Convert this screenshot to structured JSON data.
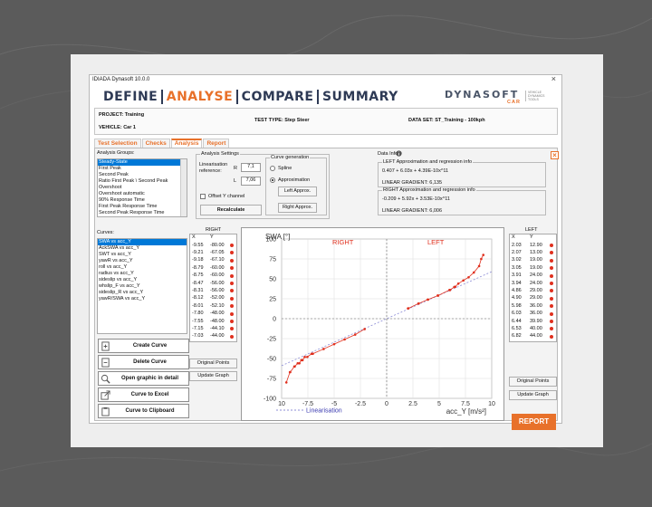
{
  "window": {
    "title": "IDIADA Dynasoft 10.0.0",
    "close": "×"
  },
  "nav": {
    "define": "DEFINE",
    "analyse": "ANALYSE",
    "compare": "COMPARE",
    "summary": "SUMMARY"
  },
  "logo": {
    "main": "DYNASOFT",
    "sub": "CAR",
    "tagline": "VEHICLE DYNAMICS TOOLS"
  },
  "info": {
    "project": "PROJECT: Training",
    "vehicle": "VEHICLE: Car 1",
    "test_type": "TEST TYPE: Step Steer",
    "data_set": "DATA SET: ST_Training - 100kph"
  },
  "tabs": [
    "Test Selection",
    "Checks",
    "Analysis",
    "Report"
  ],
  "analysis_groups": {
    "label": "Analysis Groups:",
    "items": [
      "Steady-State",
      "First Peak",
      "Second Peak",
      "Ratio First Peak \\ Second Peak",
      "Overshoot",
      "Overshoot automatic",
      "90% Response Time",
      "First Peak Response Time",
      "Second Peak Response Time"
    ],
    "selected": 0
  },
  "curves": {
    "label": "Curves:",
    "items": [
      "SWA vs acc_Y",
      "AckSWA vs acc_Y",
      "SWT vs acc_Y",
      "yawR vs acc_Y",
      "roll vs acc_Y",
      "radius vs acc_Y",
      "sideslip vs acc_Y",
      "whslip_F vs acc_Y",
      "sideslip_R vs acc_Y",
      "yawR/SWA vs acc_Y"
    ],
    "selected": 0
  },
  "analysis_settings": {
    "title": "Analysis Settings",
    "linearisation_label": "Linearisation reference:",
    "r_label": "R",
    "r_value": "7,1",
    "l_label": "L",
    "l_value": "7,06",
    "offset_label": "Offset Y channel",
    "recalculate": "Recalculate"
  },
  "curve_generation": {
    "title": "Curve generation",
    "spline": "Spline",
    "approximation": "Approximation",
    "left_btn": "Left Approx.",
    "right_btn": "Right Approx."
  },
  "data_info": {
    "title": "Data Info",
    "left_title": "LEFT Approximation and regression info",
    "left_eq": "0.407 + 6.03x + 4.39E-10x^11",
    "left_grad": "LINEAR GRADIENT: 6,135",
    "right_title": "RIGHT Approximation and regression info",
    "right_eq": "-0.209 + 5.92x + 3.53E-10x^11",
    "right_grad": "LINEAR GRADIENT: 6,006"
  },
  "right_table": {
    "title": "RIGHT",
    "col_x": "X",
    "col_y": "Y",
    "rows": [
      [
        "-9.55",
        "-80.00"
      ],
      [
        "-9.21",
        "-67.05"
      ],
      [
        "-9.18",
        "-67.10"
      ],
      [
        "-8.79",
        "-60.00"
      ],
      [
        "-8.75",
        "-60.00"
      ],
      [
        "-8.47",
        "-56.00"
      ],
      [
        "-8.31",
        "-56.00"
      ],
      [
        "-8.12",
        "-52.00"
      ],
      [
        "-8.01",
        "-52.10"
      ],
      [
        "-7.80",
        "-48.00"
      ],
      [
        "-7.55",
        "-48.00"
      ],
      [
        "-7.15",
        "-44.10"
      ],
      [
        "-7.03",
        "-44.00"
      ]
    ],
    "btn_original": "Original Points",
    "btn_update": "Update Graph"
  },
  "left_table": {
    "title": "LEFT",
    "col_x": "X",
    "col_y": "Y",
    "rows": [
      [
        "2.03",
        "12.90"
      ],
      [
        "2.07",
        "13.00"
      ],
      [
        "3.02",
        "19.00"
      ],
      [
        "3.05",
        "19.00"
      ],
      [
        "3.91",
        "24.00"
      ],
      [
        "3.94",
        "24.00"
      ],
      [
        "4.86",
        "29.00"
      ],
      [
        "4.90",
        "29.00"
      ],
      [
        "5.98",
        "36.00"
      ],
      [
        "6.03",
        "36.00"
      ],
      [
        "6.44",
        "39.90"
      ],
      [
        "6.53",
        "40.00"
      ],
      [
        "6.82",
        "44.00"
      ]
    ],
    "btn_original": "Original Points",
    "btn_update": "Update Graph"
  },
  "actions": {
    "create": "Create Curve",
    "delete": "Delete Curve",
    "open": "Open graphic in detail",
    "excel": "Curve to Excel",
    "clipboard": "Curve to Clipboard"
  },
  "report_btn": "REPORT",
  "chart_data": {
    "type": "scatter",
    "ylabel": "SWA [°]",
    "xlabel": "acc_Y [m/s²]",
    "region_right": "RIGHT",
    "region_left": "LEFT",
    "legend": "Linearisation",
    "xlim": [
      -10,
      10
    ],
    "ylim": [
      -100,
      100
    ],
    "x_ticks": [
      "10",
      "-7.5",
      "-5",
      "-2.5",
      "0",
      "2.5",
      "5",
      "7.5",
      "10"
    ],
    "y_ticks": [
      "100",
      "75",
      "50",
      "25",
      "0",
      "-25",
      "-50",
      "-75",
      "-100"
    ],
    "series": [
      {
        "values": [
          [
            -9.55,
            -80
          ],
          [
            -9.21,
            -67.05
          ],
          [
            -9.18,
            -67.1
          ],
          [
            -8.79,
            -60
          ],
          [
            -8.75,
            -60
          ],
          [
            -8.47,
            -56
          ],
          [
            -8.31,
            -56
          ],
          [
            -8.12,
            -52
          ],
          [
            -8.01,
            -52.1
          ],
          [
            -7.8,
            -48
          ],
          [
            -7.55,
            -48
          ],
          [
            -7.15,
            -44.1
          ],
          [
            -7.03,
            -44
          ],
          [
            -6.0,
            -38
          ],
          [
            -5.0,
            -32
          ],
          [
            -4.0,
            -26
          ],
          [
            -3.0,
            -20
          ],
          [
            -2.1,
            -13
          ]
        ]
      },
      {
        "values": [
          [
            2.03,
            12.9
          ],
          [
            2.07,
            13
          ],
          [
            3.02,
            19
          ],
          [
            3.05,
            19
          ],
          [
            3.91,
            24
          ],
          [
            3.94,
            24
          ],
          [
            4.86,
            29
          ],
          [
            4.9,
            29
          ],
          [
            5.98,
            36
          ],
          [
            6.03,
            36
          ],
          [
            6.44,
            39.9
          ],
          [
            6.53,
            40
          ],
          [
            6.82,
            44
          ],
          [
            7.3,
            48
          ],
          [
            7.8,
            52
          ],
          [
            8.3,
            58
          ],
          [
            8.8,
            66
          ],
          [
            9.0,
            75
          ],
          [
            9.2,
            80
          ]
        ]
      }
    ],
    "linearisation": [
      [
        -10,
        -59
      ],
      [
        10,
        59
      ]
    ]
  }
}
